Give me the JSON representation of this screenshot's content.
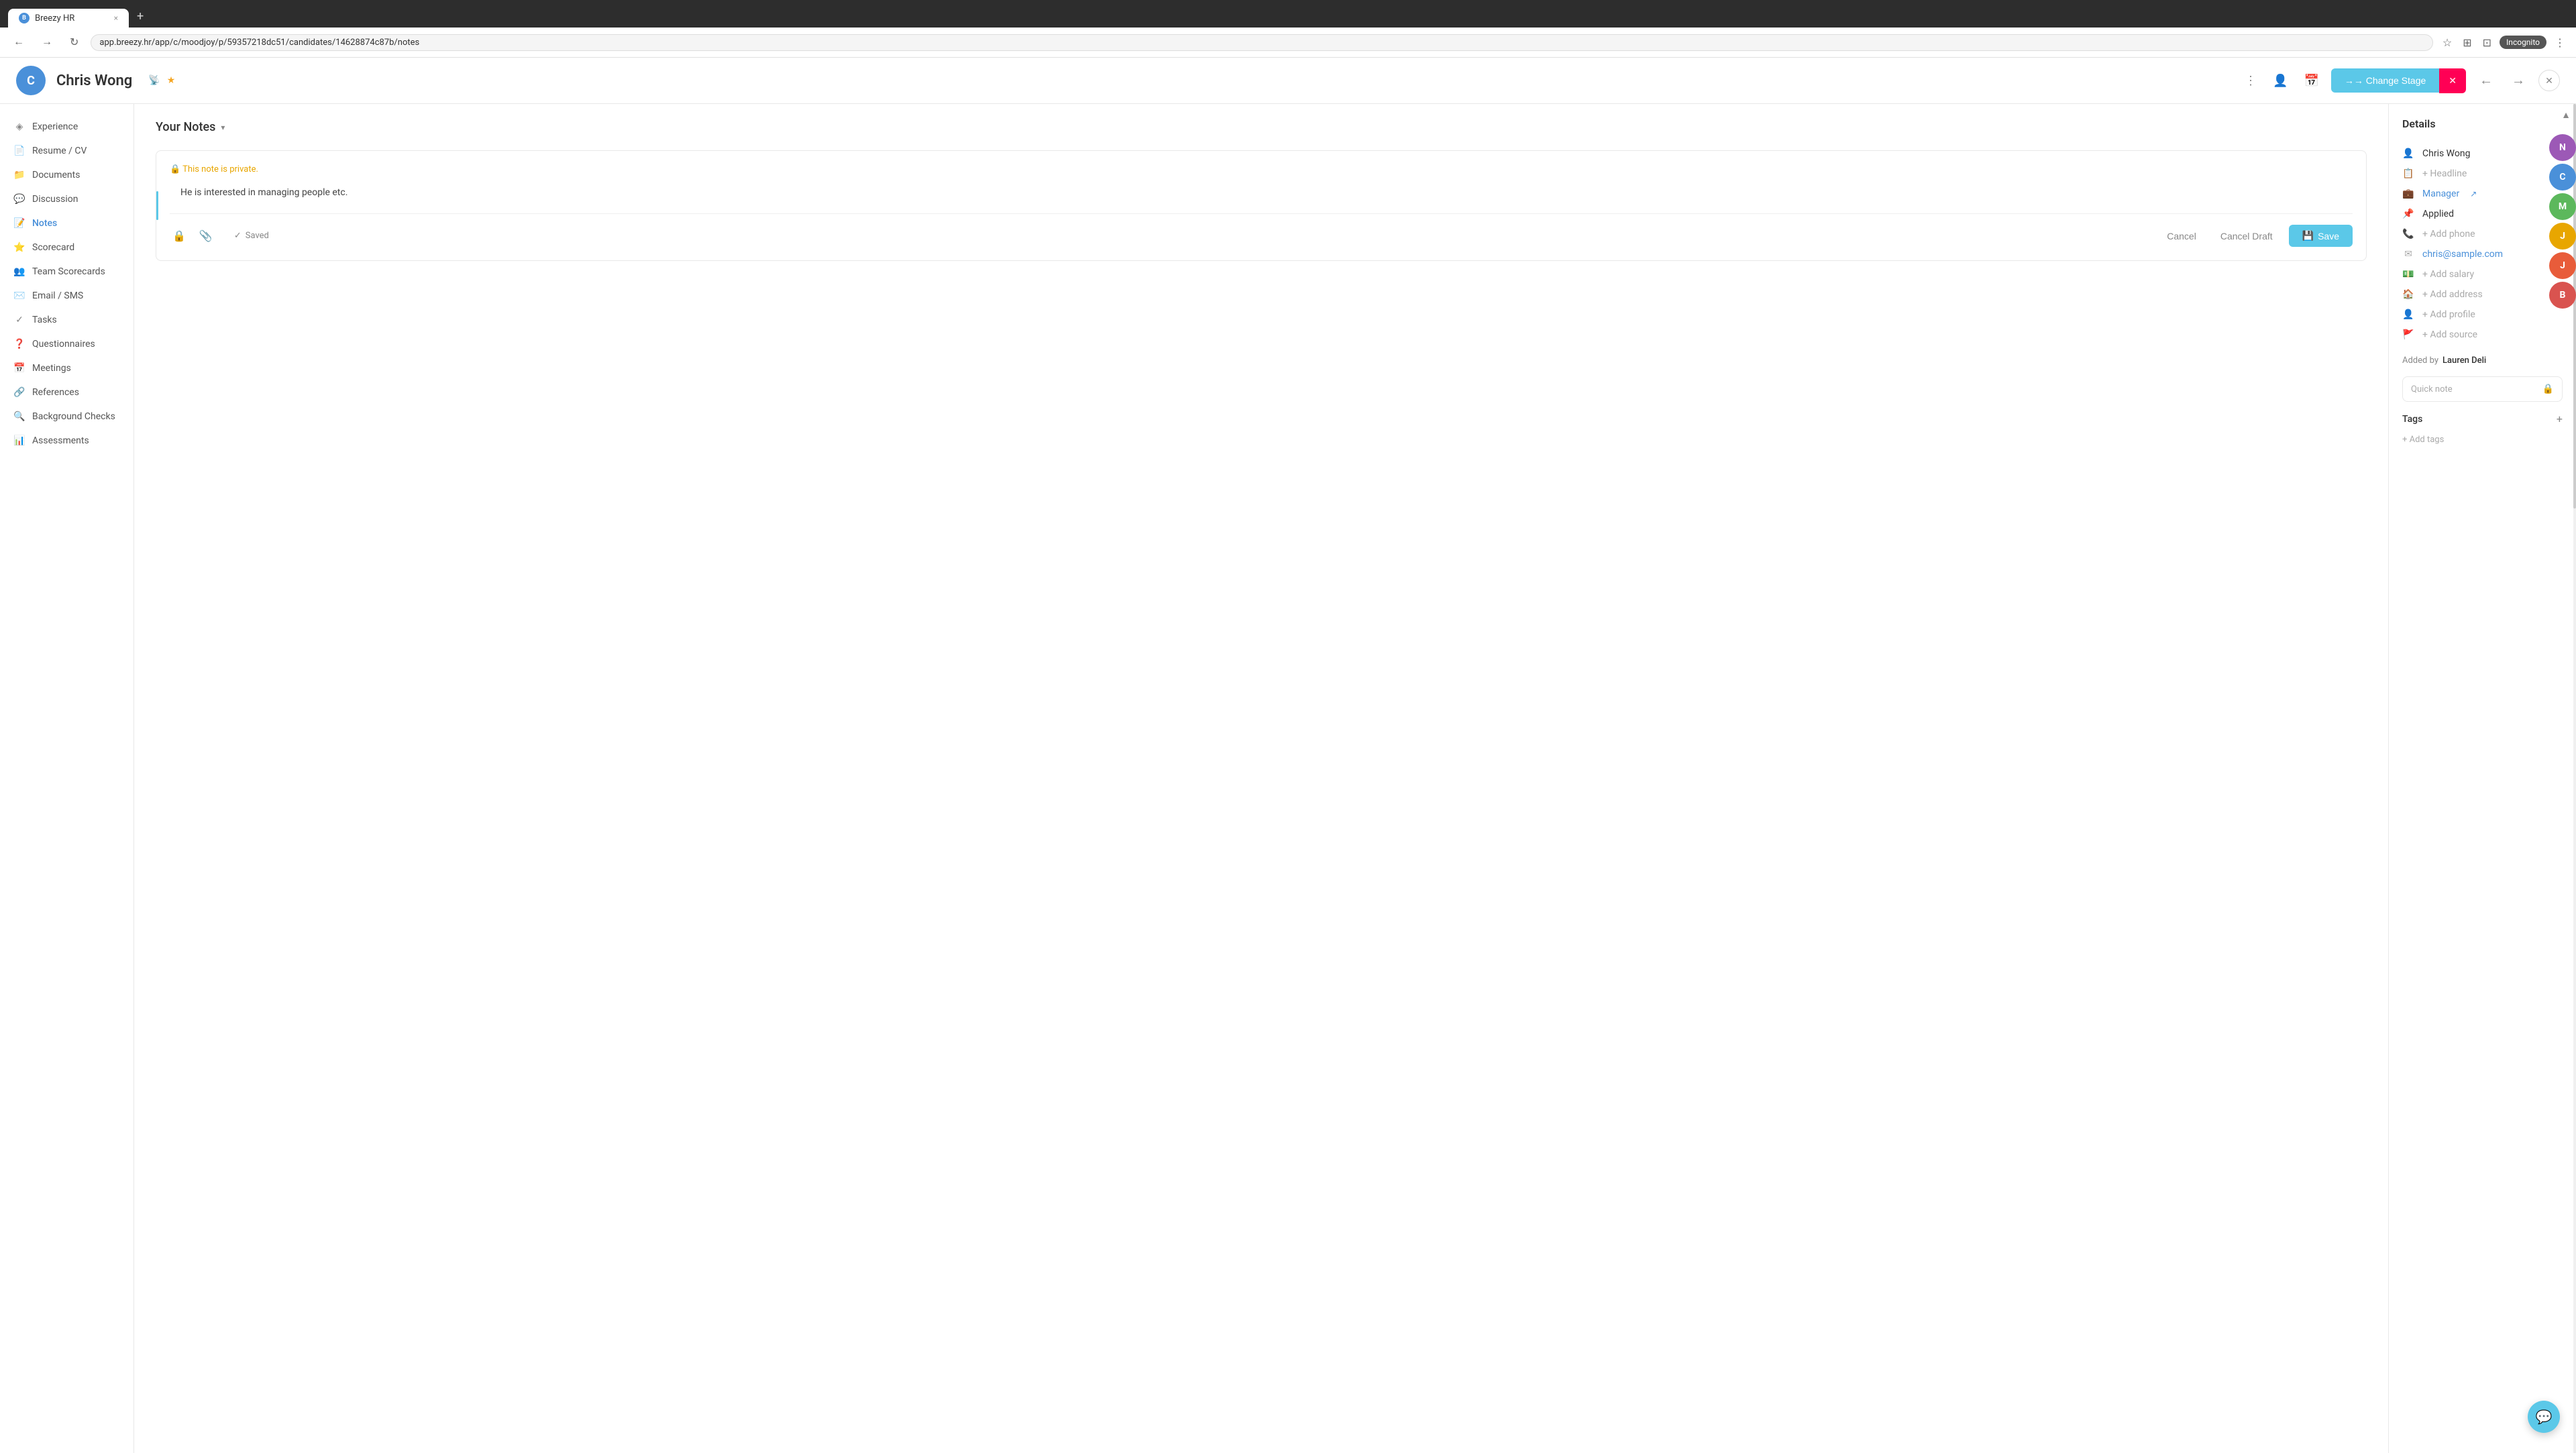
{
  "browser": {
    "tab_favicon": "B",
    "tab_title": "Breezy HR",
    "tab_close": "×",
    "tab_new": "+",
    "back_btn": "←",
    "forward_btn": "→",
    "refresh_btn": "↻",
    "address": "app.breezy.hr/app/c/moodjoy/p/59357218dc51/candidates/14628874c87b/notes",
    "star": "☆",
    "extensions": "⊞",
    "layout": "⊡",
    "incognito": "Incognito",
    "more": "⋮"
  },
  "header": {
    "avatar_letter": "C",
    "candidate_name": "Chris Wong",
    "rss_icon": "📡",
    "star_icon": "★",
    "more_icon": "⋮",
    "add_person_icon": "👤",
    "calendar_icon": "📅",
    "change_stage_label": "→→ Change Stage",
    "stage_icon": "✕",
    "prev_icon": "←",
    "next_icon": "→",
    "close_icon": "✕"
  },
  "sidebar": {
    "items": [
      {
        "id": "experience",
        "label": "Experience",
        "icon": "◈"
      },
      {
        "id": "resume",
        "label": "Resume / CV",
        "icon": "📄"
      },
      {
        "id": "documents",
        "label": "Documents",
        "icon": "📁"
      },
      {
        "id": "discussion",
        "label": "Discussion",
        "icon": "💬"
      },
      {
        "id": "notes",
        "label": "Notes",
        "icon": "📝"
      },
      {
        "id": "scorecard",
        "label": "Scorecard",
        "icon": "⭐"
      },
      {
        "id": "team-scorecards",
        "label": "Team Scorecards",
        "icon": "👥"
      },
      {
        "id": "email-sms",
        "label": "Email / SMS",
        "icon": "✉️"
      },
      {
        "id": "tasks",
        "label": "Tasks",
        "icon": "✓"
      },
      {
        "id": "questionnaires",
        "label": "Questionnaires",
        "icon": "❓"
      },
      {
        "id": "meetings",
        "label": "Meetings",
        "icon": "📅"
      },
      {
        "id": "references",
        "label": "References",
        "icon": "🔗"
      },
      {
        "id": "background-checks",
        "label": "Background Checks",
        "icon": "🔍"
      },
      {
        "id": "assessments",
        "label": "Assessments",
        "icon": "📊"
      }
    ]
  },
  "notes": {
    "header": "Your Notes",
    "dropdown_arrow": "▾",
    "private_label": "🔒 This note is private.",
    "note_content": "He is interested in managing people etc.",
    "saved_status": "Saved",
    "cancel_label": "Cancel",
    "cancel_draft_label": "Cancel Draft",
    "save_label": "Save",
    "save_icon": "💾"
  },
  "details": {
    "title": "Details",
    "person_icon": "👤",
    "candidate_name": "Chris Wong",
    "headline_icon": "📋",
    "headline_placeholder": "+ Headline",
    "manager_icon": "💼",
    "manager_label": "Manager",
    "manager_link_icon": "↗",
    "applied_icon": "📌",
    "applied_label": "Applied",
    "phone_icon": "📞",
    "phone_placeholder": "+ Add phone",
    "email_icon": "✉",
    "email_value": "chris@sample.com",
    "salary_icon": "💵",
    "salary_placeholder": "+ Add salary",
    "address_icon": "🏠",
    "address_placeholder": "+ Add address",
    "profile_icon": "👤",
    "profile_placeholder": "+ Add profile",
    "source_icon": "🚩",
    "source_placeholder": "+ Add source",
    "added_by_label": "Added by",
    "added_by_name": "Lauren Deli",
    "quick_note_placeholder": "Quick note",
    "quick_note_lock": "🔒",
    "tags_title": "Tags",
    "tags_add_icon": "+",
    "tags_placeholder": "+ Add tags"
  },
  "floating_avatars": [
    {
      "letter": "N",
      "color": "#9c59b6"
    },
    {
      "letter": "C",
      "color": "#4a90d9"
    },
    {
      "letter": "M",
      "color": "#5cb85c"
    },
    {
      "letter": "J",
      "color": "#e8a600"
    },
    {
      "letter": "J",
      "color": "#e85c3a"
    },
    {
      "letter": "B",
      "color": "#d9534f"
    }
  ]
}
